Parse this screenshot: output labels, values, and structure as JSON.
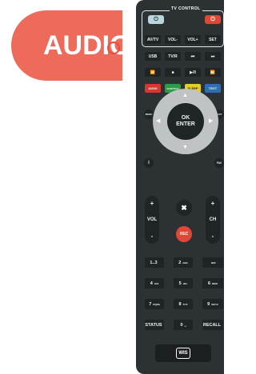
{
  "tag": {
    "label": "AUDIO"
  },
  "tv_control": {
    "title": "TV CONTROL",
    "power_icon": "⏻",
    "row": [
      "AV/TV",
      "VOL-",
      "VOL+",
      "SET"
    ]
  },
  "rows": {
    "media1": [
      "USB",
      "TV/R",
      "⏮",
      "⏭"
    ],
    "media2": [
      "⏪",
      "■",
      "▶/‖",
      "⏩"
    ],
    "color": [
      {
        "label": "AUDIO",
        "color": "#d9362d"
      },
      {
        "label": "SUBTITLE",
        "color": "#2f9b48"
      },
      {
        "label": "SLEEP",
        "color": "#e5cc2b"
      },
      {
        "label": "TEXT",
        "color": "#2d6fb6"
      }
    ]
  },
  "nav": {
    "menu": "MENU",
    "exit": "EXIT",
    "ok": "OK",
    "enter": "ENTER",
    "info": "i",
    "fav": "FAV"
  },
  "volume": {
    "plus": "+",
    "label": "VOL",
    "minus": "-"
  },
  "channel": {
    "plus": "+",
    "label": "CH",
    "minus": "-"
  },
  "mute_icon": "✖",
  "rec": "REC",
  "keypad": [
    [
      {
        "main": "1..3",
        "sub": ""
      },
      {
        "main": "2",
        "sub": "ABC"
      },
      {
        "main": "",
        "sub": "DEF"
      }
    ],
    [
      {
        "main": "4",
        "sub": "GHI"
      },
      {
        "main": "5",
        "sub": "JKL"
      },
      {
        "main": "6",
        "sub": "MNO"
      }
    ],
    [
      {
        "main": "7",
        "sub": "PQRS"
      },
      {
        "main": "8",
        "sub": "TUV"
      },
      {
        "main": "9",
        "sub": "WXYZ"
      }
    ],
    [
      {
        "main": "STATUS",
        "sub": ""
      },
      {
        "main": "0",
        "sub": "␣"
      },
      {
        "main": "RECALL",
        "sub": ""
      }
    ]
  ],
  "brand": "WIS"
}
